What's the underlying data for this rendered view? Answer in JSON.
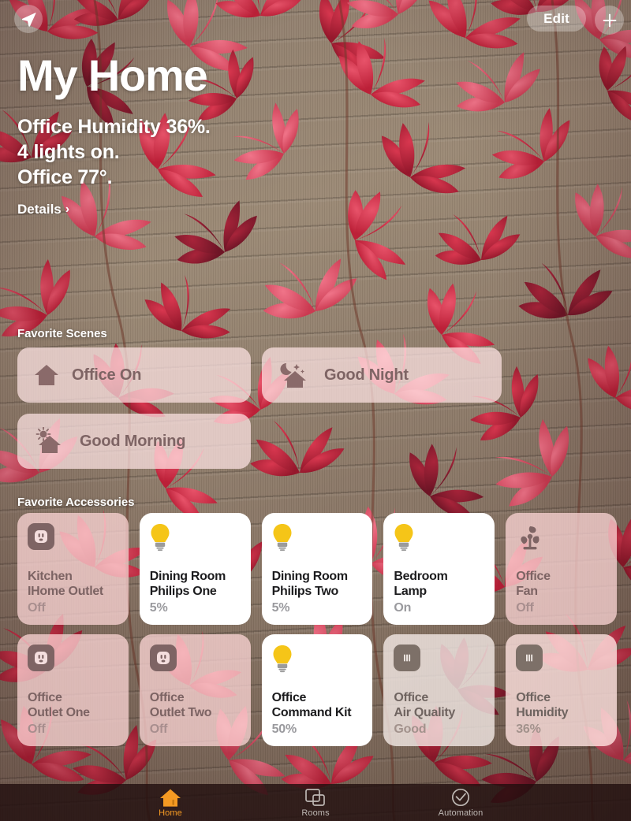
{
  "app": {
    "name": "Home"
  },
  "topbar": {
    "location_icon": "location-arrow-icon",
    "edit_label": "Edit",
    "add_icon": "plus-icon"
  },
  "header": {
    "title": "My Home",
    "status_lines": [
      "Office Humidity 36%.",
      "4 lights on.",
      "Office 77°."
    ],
    "details_label": "Details",
    "details_chevron": "›"
  },
  "sections": {
    "scenes_label": "Favorite Scenes",
    "accessories_label": "Favorite Accessories"
  },
  "scenes": [
    {
      "name": "Office On",
      "icon": "house-icon"
    },
    {
      "name": "Good Night",
      "icon": "moon-house-icon"
    },
    {
      "name": "Good Morning",
      "icon": "sun-house-icon"
    }
  ],
  "accessories": [
    {
      "name_line1": "Kitchen",
      "name_line2": "IHome Outlet",
      "state": "Off",
      "icon": "outlet-icon",
      "style": "off"
    },
    {
      "name_line1": "Dining Room",
      "name_line2": "Philips One",
      "state": "5%",
      "icon": "lightbulb-icon",
      "style": "on"
    },
    {
      "name_line1": "Dining Room",
      "name_line2": "Philips Two",
      "state": "5%",
      "icon": "lightbulb-icon",
      "style": "on"
    },
    {
      "name_line1": "Bedroom",
      "name_line2": "Lamp",
      "state": "On",
      "icon": "lightbulb-icon",
      "style": "on"
    },
    {
      "name_line1": "Office",
      "name_line2": "Fan",
      "state": "Off",
      "icon": "fan-icon",
      "style": "off"
    },
    {
      "name_line1": "Office",
      "name_line2": "Outlet One",
      "state": "Off",
      "icon": "outlet-icon",
      "style": "off"
    },
    {
      "name_line1": "Office",
      "name_line2": "Outlet Two",
      "state": "Off",
      "icon": "outlet-icon",
      "style": "off"
    },
    {
      "name_line1": "Office",
      "name_line2": "Command Kit",
      "state": "50%",
      "icon": "lightbulb-icon",
      "style": "on"
    },
    {
      "name_line1": "Office",
      "name_line2": "Air Quality",
      "state": "Good",
      "icon": "sensor-icon",
      "style": "sensor-q"
    },
    {
      "name_line1": "Office",
      "name_line2": "Humidity",
      "state": "36%",
      "icon": "sensor-icon",
      "style": "sensor-h"
    }
  ],
  "tabs": [
    {
      "label": "Home",
      "icon": "house-icon",
      "active": true
    },
    {
      "label": "Rooms",
      "icon": "rooms-icon",
      "active": false
    },
    {
      "label": "Automation",
      "icon": "clock-check-icon",
      "active": false
    }
  ],
  "colors": {
    "accent": "#f59a23",
    "bulb_on": "#f5c518",
    "card_on": "#ffffff",
    "card_off": "#ffd8d8",
    "scene_card": "#ffe4e4",
    "tabbar": "#200e0e"
  }
}
